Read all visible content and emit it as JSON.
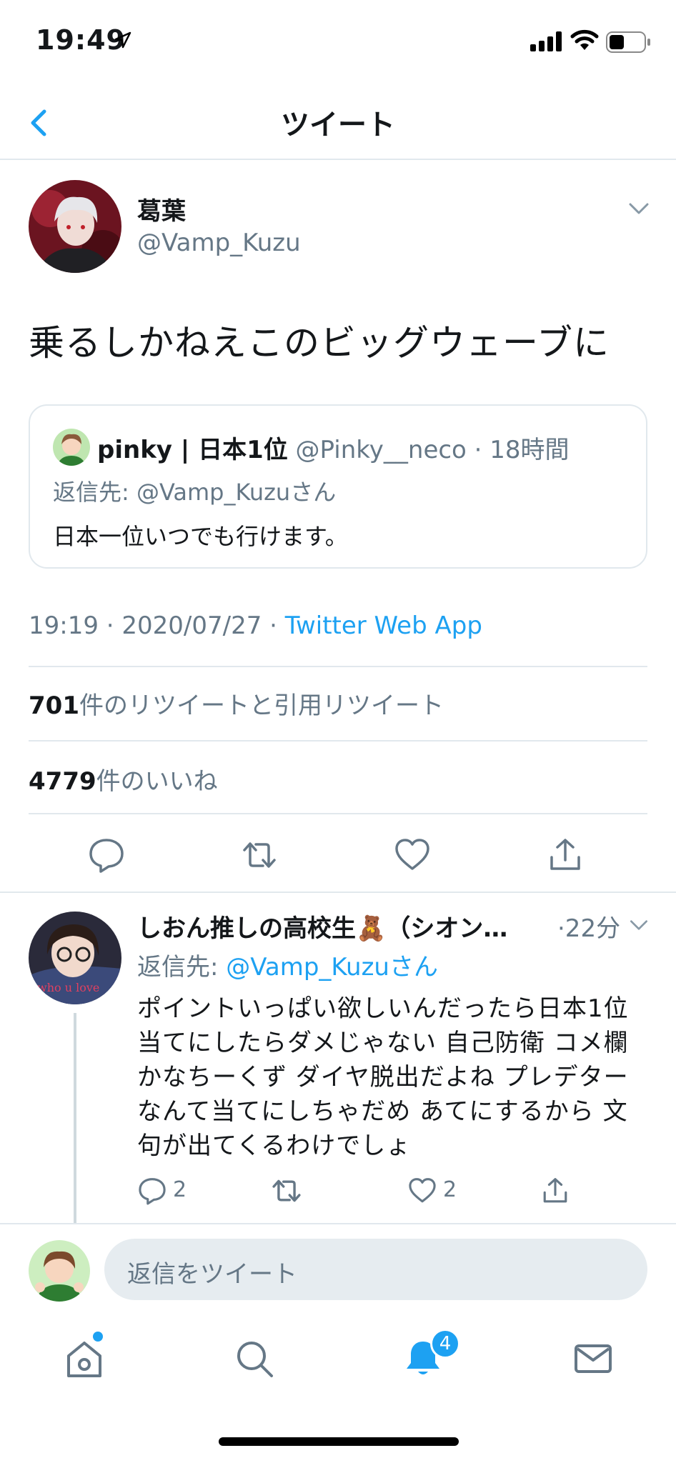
{
  "status_bar": {
    "time": "19:49"
  },
  "nav": {
    "title": "ツイート"
  },
  "tweet": {
    "author_name": "葛葉",
    "author_handle": "@Vamp_Kuzu",
    "text": "乗るしかねえこのビッグウェーブに",
    "quote": {
      "name": "pinky | 日本1位",
      "handle": "@Pinky__neco",
      "time": "18時間",
      "reply_to": "返信先: @Vamp_Kuzuさん",
      "text": "日本一位いつでも行けます。"
    },
    "timestamp": "19:19 · 2020/07/27 · ",
    "source": "Twitter Web App",
    "retweet_count": "701",
    "retweet_label": "件のリツイートと引用リツイート",
    "like_count": "4779",
    "like_label": "件のいいね"
  },
  "reply": {
    "name": "しおん推しの高校生🧸（シオン…",
    "time": "·22分",
    "reply_to_prefix": "返信先: ",
    "reply_to_mention": "@Vamp_Kuzuさん",
    "lines": [
      "ポイントいっぱい欲しいんだったら日本1位",
      "当てにしたらダメじゃない 自己防衛 コメ欄",
      "かなちーくず ダイヤ脱出だよね プレデター",
      "なんて当てにしちゃだめ あてにするから 文",
      "句が出てくるわけでしょ"
    ],
    "reply_count": "2",
    "like_count": "2"
  },
  "composer": {
    "placeholder": "返信をツイート"
  },
  "tabbar": {
    "notification_badge": "4"
  },
  "icons": [
    "back-icon",
    "chevron-down-icon",
    "reply-icon",
    "retweet-icon",
    "like-icon",
    "share-icon",
    "home-icon",
    "search-icon",
    "notifications-icon",
    "messages-icon"
  ],
  "colors": {
    "accent": "#1da1f2",
    "text": "#14171a",
    "secondary": "#657786",
    "border": "#e1e8ed"
  }
}
